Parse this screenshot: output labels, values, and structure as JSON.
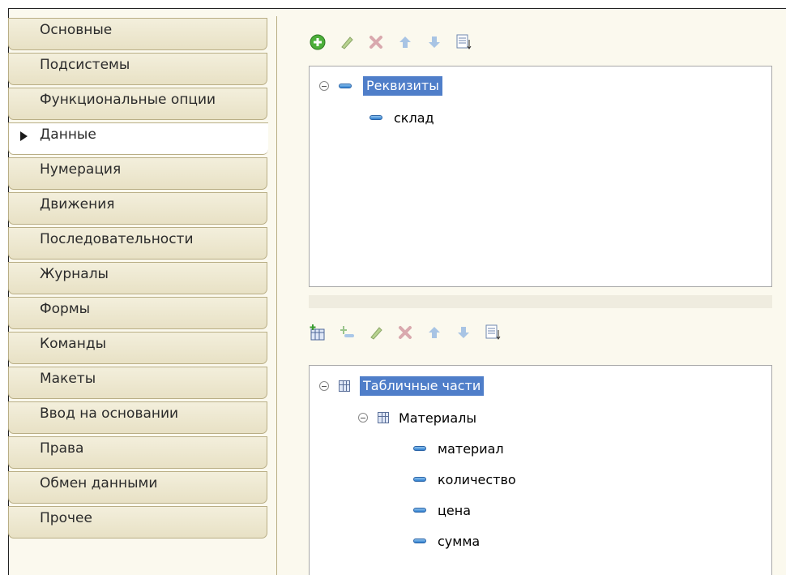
{
  "sidebar": {
    "items": [
      {
        "label": "Основные"
      },
      {
        "label": "Подсистемы"
      },
      {
        "label": "Функциональные опции"
      },
      {
        "label": "Данные"
      },
      {
        "label": "Нумерация"
      },
      {
        "label": "Движения"
      },
      {
        "label": "Последовательности"
      },
      {
        "label": "Журналы"
      },
      {
        "label": "Формы"
      },
      {
        "label": "Команды"
      },
      {
        "label": "Макеты"
      },
      {
        "label": "Ввод на основании"
      },
      {
        "label": "Права"
      },
      {
        "label": "Обмен данными"
      },
      {
        "label": "Прочее"
      }
    ],
    "active": "Данные"
  },
  "attributes_panel": {
    "root_label": "Реквизиты",
    "items": [
      "склад"
    ]
  },
  "tabular_panel": {
    "root_label": "Табличные части",
    "group_label": "Материалы",
    "items": [
      "материал",
      "количество",
      "цена",
      "сумма"
    ]
  },
  "icons": {
    "top_toolbar": [
      "add-icon",
      "edit-icon",
      "delete-icon",
      "move-up-icon",
      "move-down-icon",
      "sort-icon"
    ],
    "bottom_toolbar": [
      "add-table-icon",
      "add-attribute-icon",
      "edit-icon",
      "delete-icon",
      "move-up-icon",
      "move-down-icon",
      "sort-icon"
    ]
  },
  "colors": {
    "selection": "#4f7ec9",
    "tab_background": "#e8e1c5",
    "panel_background": "#fbf9ee"
  }
}
